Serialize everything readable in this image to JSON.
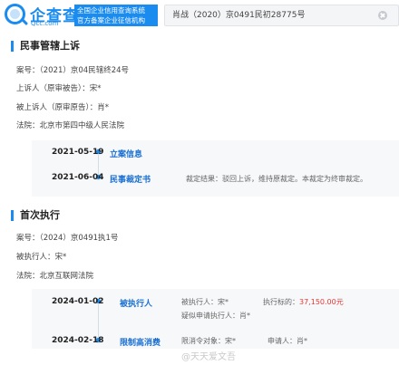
{
  "header": {
    "brand": "企查查",
    "brand_url": "Qcc.com",
    "slogan_line1": "全国企业信用查询系统",
    "slogan_line2": "官方备案企业征信机构",
    "search_value": "肖战（2020）京0491民初28775号"
  },
  "appeal_section": {
    "title": "民事管辖上诉",
    "case_no": "案号：（2021）京04民辖终24号",
    "appellant": "上诉人（原审被告）：宋*",
    "appellee": "被上诉人（原审原告）：肖*",
    "court": "法院：北京市第四中级人民法院",
    "timeline": [
      {
        "date": "2021-05-19",
        "type": "立案信息",
        "detail": ""
      },
      {
        "date": "2021-06-04",
        "type": "民事裁定书",
        "detail": "裁定结果：驳回上诉，维持原裁定。本裁定为终审裁定。"
      }
    ]
  },
  "execution_section": {
    "title": "首次执行",
    "case_no": "案号：（2024）京0491执1号",
    "executed": "被执行人：宋*",
    "court": "法院：北京互联网法院",
    "timeline": [
      {
        "date": "2024-01-02",
        "type": "被执行人",
        "detail_a": "被执行人：宋*",
        "detail_b_label": "执行标的：",
        "detail_b_value": "37,150.00元",
        "detail_c": "疑似申请执行人：肖*"
      },
      {
        "date": "2024-02-18",
        "type": "限制高消费",
        "detail_a": "限消令对象：宋*",
        "detail_b": "申请人：肖*"
      }
    ]
  },
  "watermark": "@天天爱文吾",
  "colors": {
    "accent": "#1a8cf0",
    "amount": "#e53935"
  }
}
